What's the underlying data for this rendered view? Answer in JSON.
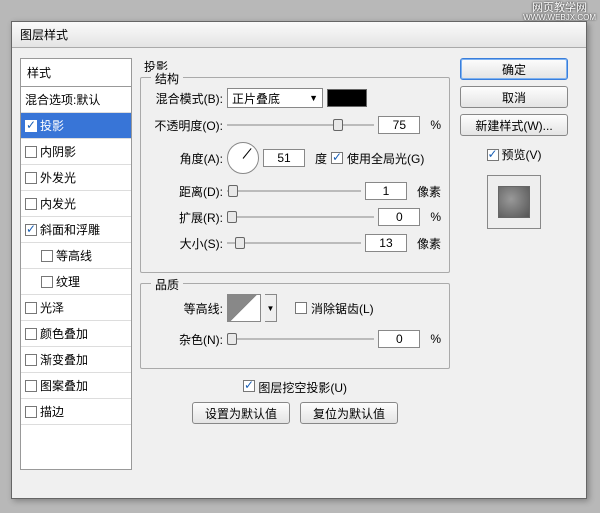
{
  "watermark": {
    "line1": "网页教学网",
    "line2": "WWW.WEBJX.COM"
  },
  "dialog_title": "图层样式",
  "styles_header": "样式",
  "styles": [
    {
      "label": "混合选项:默认",
      "checked": false,
      "nocb": true
    },
    {
      "label": "投影",
      "checked": true,
      "selected": true
    },
    {
      "label": "内阴影",
      "checked": false
    },
    {
      "label": "外发光",
      "checked": false
    },
    {
      "label": "内发光",
      "checked": false
    },
    {
      "label": "斜面和浮雕",
      "checked": true
    },
    {
      "label": "等高线",
      "checked": false,
      "indent": true
    },
    {
      "label": "纹理",
      "checked": false,
      "indent": true
    },
    {
      "label": "光泽",
      "checked": false
    },
    {
      "label": "颜色叠加",
      "checked": false
    },
    {
      "label": "渐变叠加",
      "checked": false
    },
    {
      "label": "图案叠加",
      "checked": false
    },
    {
      "label": "描边",
      "checked": false
    }
  ],
  "main_title": "投影",
  "structure": {
    "legend": "结构",
    "blend_mode_label": "混合模式(B):",
    "blend_mode_value": "正片叠底",
    "opacity_label": "不透明度(O):",
    "opacity_value": "75",
    "opacity_unit": "%",
    "angle_label": "角度(A):",
    "angle_value": "51",
    "angle_unit": "度",
    "global_light_label": "使用全局光(G)",
    "distance_label": "距离(D):",
    "distance_value": "1",
    "distance_unit": "像素",
    "spread_label": "扩展(R):",
    "spread_value": "0",
    "spread_unit": "%",
    "size_label": "大小(S):",
    "size_value": "13",
    "size_unit": "像素"
  },
  "quality": {
    "legend": "品质",
    "contour_label": "等高线:",
    "antialias_label": "消除锯齿(L)",
    "noise_label": "杂色(N):",
    "noise_value": "0",
    "noise_unit": "%"
  },
  "knockout_label": "图层挖空投影(U)",
  "set_default": "设置为默认值",
  "reset_default": "复位为默认值",
  "right": {
    "ok": "确定",
    "cancel": "取消",
    "new_style": "新建样式(W)...",
    "preview": "预览(V)"
  }
}
